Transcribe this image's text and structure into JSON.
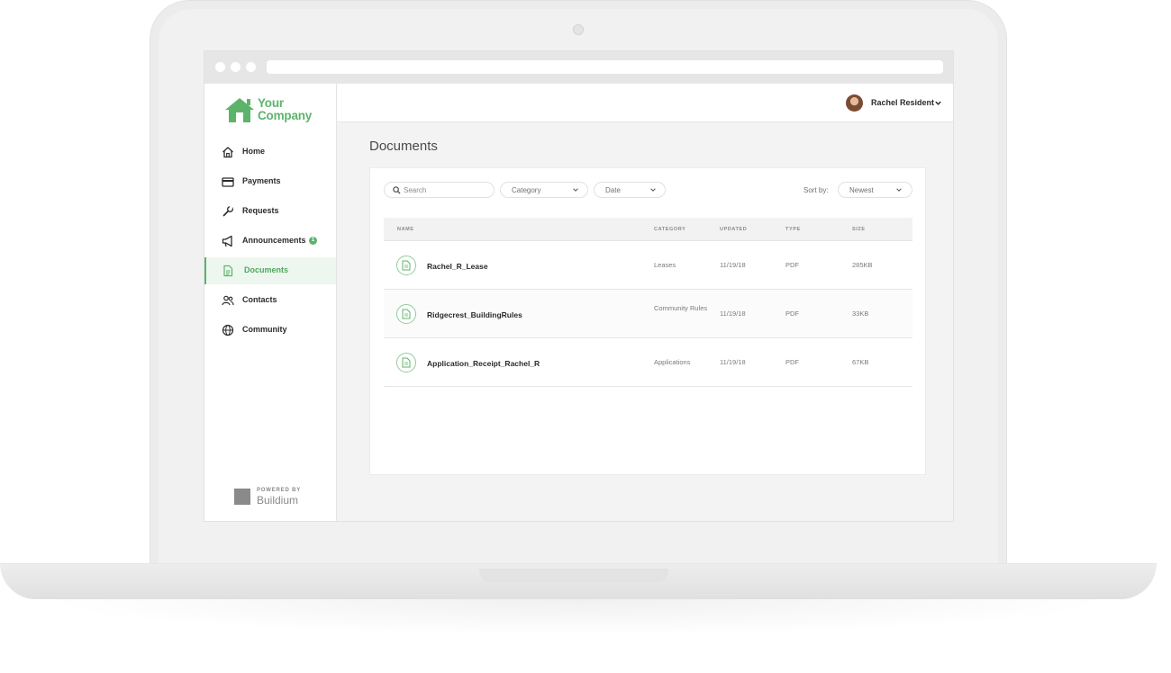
{
  "brand": {
    "company_line1": "Your",
    "company_line2": "Company",
    "logo_icon": "house-icon",
    "accent_color": "#5cb46a",
    "powered_by_label": "POWERED BY",
    "powered_by_brand": "Buildium"
  },
  "sidebar": {
    "items": [
      {
        "label": "Home",
        "icon": "home-icon"
      },
      {
        "label": "Payments",
        "icon": "credit-card-icon"
      },
      {
        "label": "Requests",
        "icon": "wrench-icon"
      },
      {
        "label": "Announcements",
        "icon": "megaphone-icon",
        "badge": "1"
      },
      {
        "label": "Documents",
        "icon": "document-icon",
        "active": true
      },
      {
        "label": "Contacts",
        "icon": "people-icon"
      },
      {
        "label": "Community",
        "icon": "globe-icon"
      }
    ]
  },
  "header": {
    "user_name": "Rachel Resident"
  },
  "page": {
    "title": "Documents"
  },
  "filters": {
    "search_placeholder": "Search",
    "category_label": "Category",
    "date_label": "Date",
    "sort_label": "Sort by:",
    "sort_value": "Newest"
  },
  "table": {
    "columns": [
      "NAME",
      "CATEGORY",
      "UPDATED",
      "TYPE",
      "SIZE"
    ],
    "rows": [
      {
        "name": "Rachel_R_Lease",
        "category": "Leases",
        "updated": "11/19/18",
        "type": "PDF",
        "size": "285KB"
      },
      {
        "name": "Ridgecrest_BuildingRules",
        "category": "Community Rules",
        "updated": "11/19/18",
        "type": "PDF",
        "size": "33KB"
      },
      {
        "name": "Application_Receipt_Rachel_R",
        "category": "Applications",
        "updated": "11/19/18",
        "type": "PDF",
        "size": "67KB"
      }
    ]
  }
}
